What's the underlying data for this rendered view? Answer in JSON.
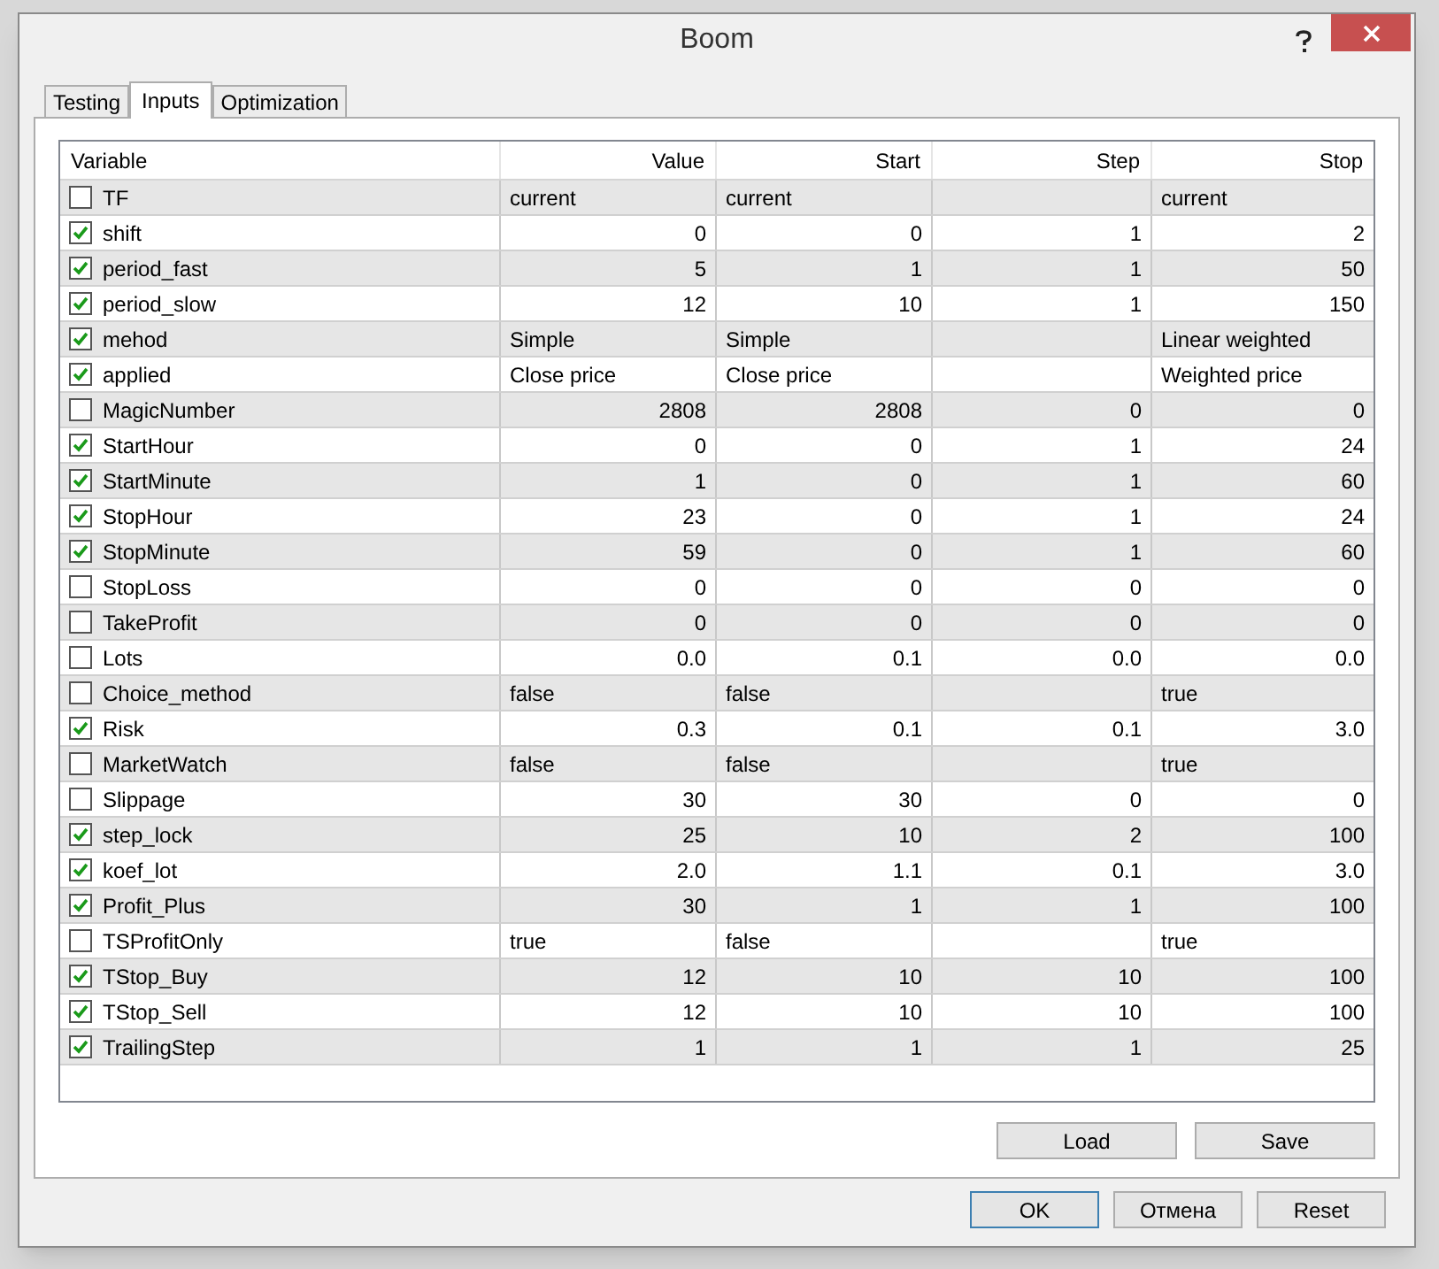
{
  "window": {
    "title": "Boom"
  },
  "tabs": [
    {
      "label": "Testing",
      "selected": false
    },
    {
      "label": "Inputs",
      "selected": true
    },
    {
      "label": "Optimization",
      "selected": false
    }
  ],
  "table": {
    "columns": [
      "Variable",
      "Value",
      "Start",
      "Step",
      "Stop"
    ],
    "rows": [
      {
        "kind": "text",
        "checked": false,
        "name": "TF",
        "value": "current",
        "start": "current",
        "stop": "current"
      },
      {
        "kind": "number",
        "checked": true,
        "name": "shift",
        "value": "0",
        "start": "0",
        "step": "1",
        "stop": "2"
      },
      {
        "kind": "number",
        "checked": true,
        "name": "period_fast",
        "value": "5",
        "start": "1",
        "step": "1",
        "stop": "50"
      },
      {
        "kind": "number",
        "checked": true,
        "name": "period_slow",
        "value": "12",
        "start": "10",
        "step": "1",
        "stop": "150"
      },
      {
        "kind": "text",
        "checked": true,
        "name": "mehod",
        "value": "Simple",
        "start": "Simple",
        "stop": "Linear weighted"
      },
      {
        "kind": "text",
        "checked": true,
        "name": "applied",
        "value": "Close price",
        "start": "Close price",
        "stop": "Weighted price"
      },
      {
        "kind": "number",
        "checked": false,
        "name": "MagicNumber",
        "value": "2808",
        "start": "2808",
        "step": "0",
        "stop": "0"
      },
      {
        "kind": "number",
        "checked": true,
        "name": "StartHour",
        "value": "0",
        "start": "0",
        "step": "1",
        "stop": "24"
      },
      {
        "kind": "number",
        "checked": true,
        "name": "StartMinute",
        "value": "1",
        "start": "0",
        "step": "1",
        "stop": "60"
      },
      {
        "kind": "number",
        "checked": true,
        "name": "StopHour",
        "value": "23",
        "start": "0",
        "step": "1",
        "stop": "24"
      },
      {
        "kind": "number",
        "checked": true,
        "name": "StopMinute",
        "value": "59",
        "start": "0",
        "step": "1",
        "stop": "60"
      },
      {
        "kind": "number",
        "checked": false,
        "name": "StopLoss",
        "value": "0",
        "start": "0",
        "step": "0",
        "stop": "0"
      },
      {
        "kind": "number",
        "checked": false,
        "name": "TakeProfit",
        "value": "0",
        "start": "0",
        "step": "0",
        "stop": "0"
      },
      {
        "kind": "number",
        "checked": false,
        "name": "Lots",
        "value": "0.0",
        "start": "0.1",
        "step": "0.0",
        "stop": "0.0"
      },
      {
        "kind": "text",
        "checked": false,
        "name": "Choice_method",
        "value": "false",
        "start": "false",
        "stop": "true"
      },
      {
        "kind": "number",
        "checked": true,
        "name": "Risk",
        "value": "0.3",
        "start": "0.1",
        "step": "0.1",
        "stop": "3.0"
      },
      {
        "kind": "text",
        "checked": false,
        "name": "MarketWatch",
        "value": "false",
        "start": "false",
        "stop": "true"
      },
      {
        "kind": "number",
        "checked": false,
        "name": "Slippage",
        "value": "30",
        "start": "30",
        "step": "0",
        "stop": "0"
      },
      {
        "kind": "number",
        "checked": true,
        "name": "step_lock",
        "value": "25",
        "start": "10",
        "step": "2",
        "stop": "100"
      },
      {
        "kind": "number",
        "checked": true,
        "name": "koef_lot",
        "value": "2.0",
        "start": "1.1",
        "step": "0.1",
        "stop": "3.0"
      },
      {
        "kind": "number",
        "checked": true,
        "name": "Profit_Plus",
        "value": "30",
        "start": "1",
        "step": "1",
        "stop": "100"
      },
      {
        "kind": "text",
        "checked": false,
        "name": "TSProfitOnly",
        "value": "true",
        "start": "false",
        "stop": "true"
      },
      {
        "kind": "number",
        "checked": true,
        "name": "TStop_Buy",
        "value": "12",
        "start": "10",
        "step": "10",
        "stop": "100"
      },
      {
        "kind": "number",
        "checked": true,
        "name": "TStop_Sell",
        "value": "12",
        "start": "10",
        "step": "10",
        "stop": "100"
      },
      {
        "kind": "number",
        "checked": true,
        "name": "TrailingStep",
        "value": "1",
        "start": "1",
        "step": "1",
        "stop": "25"
      }
    ]
  },
  "panel_buttons": [
    "Load",
    "Save"
  ],
  "dialog_buttons": [
    {
      "label": "OK",
      "selected": true
    },
    {
      "label": "Отмена",
      "selected": false
    },
    {
      "label": "Reset",
      "selected": false
    }
  ]
}
